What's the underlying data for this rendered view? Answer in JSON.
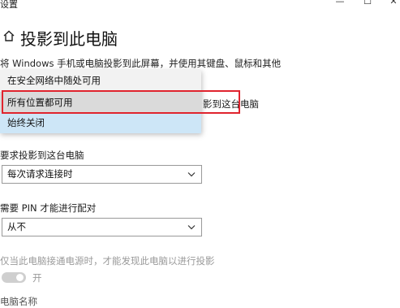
{
  "window": {
    "title": "设置",
    "min_glyph": "—",
    "max_glyph": "☐",
    "close_glyph": "✕"
  },
  "page": {
    "title": "投影到此电脑",
    "description": "将 Windows 手机或电脑投影到此屏幕，并使用其键盘、鼠标和其他",
    "partial_text": "影到这台电脑"
  },
  "dropdown": {
    "options": [
      "在安全网络中随处可用",
      "所有位置都可用",
      "始终关闭"
    ],
    "hovered": "所有位置都可用",
    "selected": "始终关闭"
  },
  "settings": {
    "request_label": "要求投影到这台电脑",
    "request_value": "每次请求连接时",
    "pin_label": "需要 PIN 才能进行配对",
    "pin_value": "从不",
    "power_hint": "仅当此电脑接通电源时，才能发现此电脑以进行投影",
    "toggle_label": "开",
    "toggle_on": true,
    "cut_label": "电脑名称"
  },
  "colors": {
    "highlight_border": "#e0242e",
    "selected_bg": "#cde6f7",
    "hover_bg": "#dadada"
  }
}
